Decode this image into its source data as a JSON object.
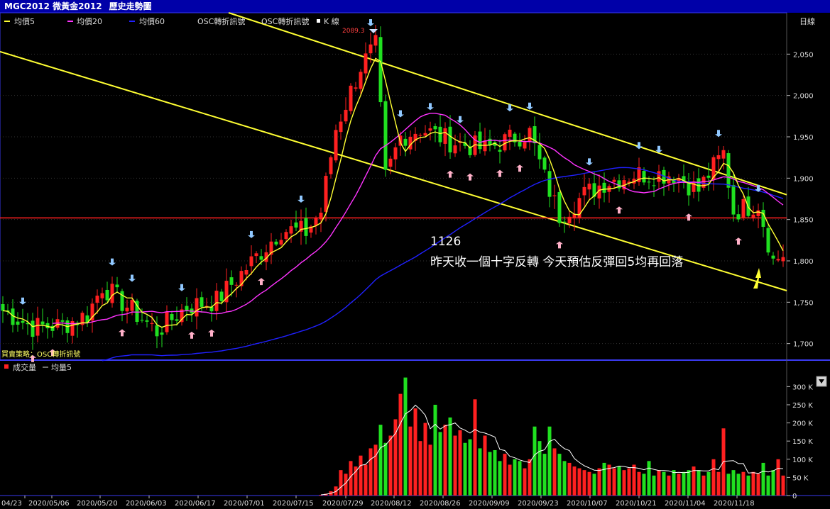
{
  "window": {
    "title": "MGC2012 微黃金2012",
    "subtitle": "歷史走勢圖"
  },
  "legend_main": {
    "ma5": "均價5",
    "ma20": "均價20",
    "ma60": "均價60",
    "osc1": "OSC轉折訊號",
    "osc2": "OSC轉折訊號",
    "kline": "K 線",
    "period": "日線"
  },
  "strategy_label": "買賣策略：OSC轉折訊號",
  "annotation": {
    "code": "1126",
    "text": "昨天收一個十字反轉 今天預估反彈回5均再回落"
  },
  "high_marker": "2089.3",
  "legend_volume": {
    "volume": "成交量",
    "ma5": "均量5"
  },
  "colors": {
    "up": "#ff2020",
    "down": "#20e020",
    "ma5": "#ffff33",
    "ma20": "#ff33ff",
    "ma60": "#2020ff",
    "trend": "#ffff33",
    "support": "#ff2020",
    "title_bg": "#0000a8",
    "buy_arrow": "#ffb0c8",
    "sell_arrow": "#90c8ff"
  },
  "chart_data": [
    {
      "type": "candlestick",
      "title": "",
      "ylim": [
        1680,
        2100
      ],
      "yticks": [
        1700,
        1750,
        1800,
        1850,
        1900,
        1950,
        2000,
        2050
      ],
      "ytick_labels": [
        "1,700",
        "1,750",
        "1,800",
        "1,850",
        "1,900",
        "1,950",
        "2,000",
        "2,050"
      ],
      "xticks": [
        "04/23",
        "2020/05/06",
        "2020/05/20",
        "2020/06/03",
        "2020/06/17",
        "2020/07/01",
        "2020/07/15",
        "2020/07/29",
        "2020/08/12",
        "2020/08/26",
        "2020/09/09",
        "2020/09/23",
        "2020/10/07",
        "2020/10/21",
        "2020/11/04",
        "2020/11/18"
      ],
      "support_level": 1852,
      "high": 2089.3,
      "series": [
        {
          "name": "均價5"
        },
        {
          "name": "均價20"
        },
        {
          "name": "均價60"
        }
      ]
    },
    {
      "type": "bar",
      "title": "",
      "ylim": [
        0,
        330000
      ],
      "yticks": [
        0,
        50000,
        100000,
        150000,
        200000,
        250000,
        300000
      ],
      "ytick_labels": [
        "0",
        "50 K",
        "100 K",
        "150 K",
        "200 K",
        "250 K",
        "300 K"
      ],
      "volume_start_date": "2020/07/21",
      "volumes": [
        2000,
        5000,
        12000,
        25000,
        70000,
        60000,
        95000,
        80000,
        110000,
        85000,
        130000,
        140000,
        195000,
        145000,
        165000,
        210000,
        280000,
        325000,
        190000,
        240000,
        150000,
        200000,
        140000,
        250000,
        175000,
        195000,
        215000,
        165000,
        180000,
        145000,
        155000,
        265000,
        130000,
        165000,
        120000,
        125000,
        95000,
        115000,
        85000,
        100000,
        95000,
        75000,
        100000,
        190000,
        150000,
        115000,
        190000,
        130000,
        115000,
        95000,
        90000,
        80000,
        75000,
        70000,
        65000,
        60000,
        75000,
        90000,
        85000,
        75000,
        80000,
        70000,
        75000,
        85000,
        65000,
        60000,
        95000,
        55000,
        70000,
        65000,
        55000,
        70000,
        60000,
        65000,
        70000,
        80000,
        70000,
        55000,
        65000,
        100000,
        65000,
        185000,
        60000,
        70000,
        60000,
        65000,
        55000,
        65000,
        60000,
        90000,
        55000,
        70000,
        100000,
        55000
      ]
    }
  ]
}
